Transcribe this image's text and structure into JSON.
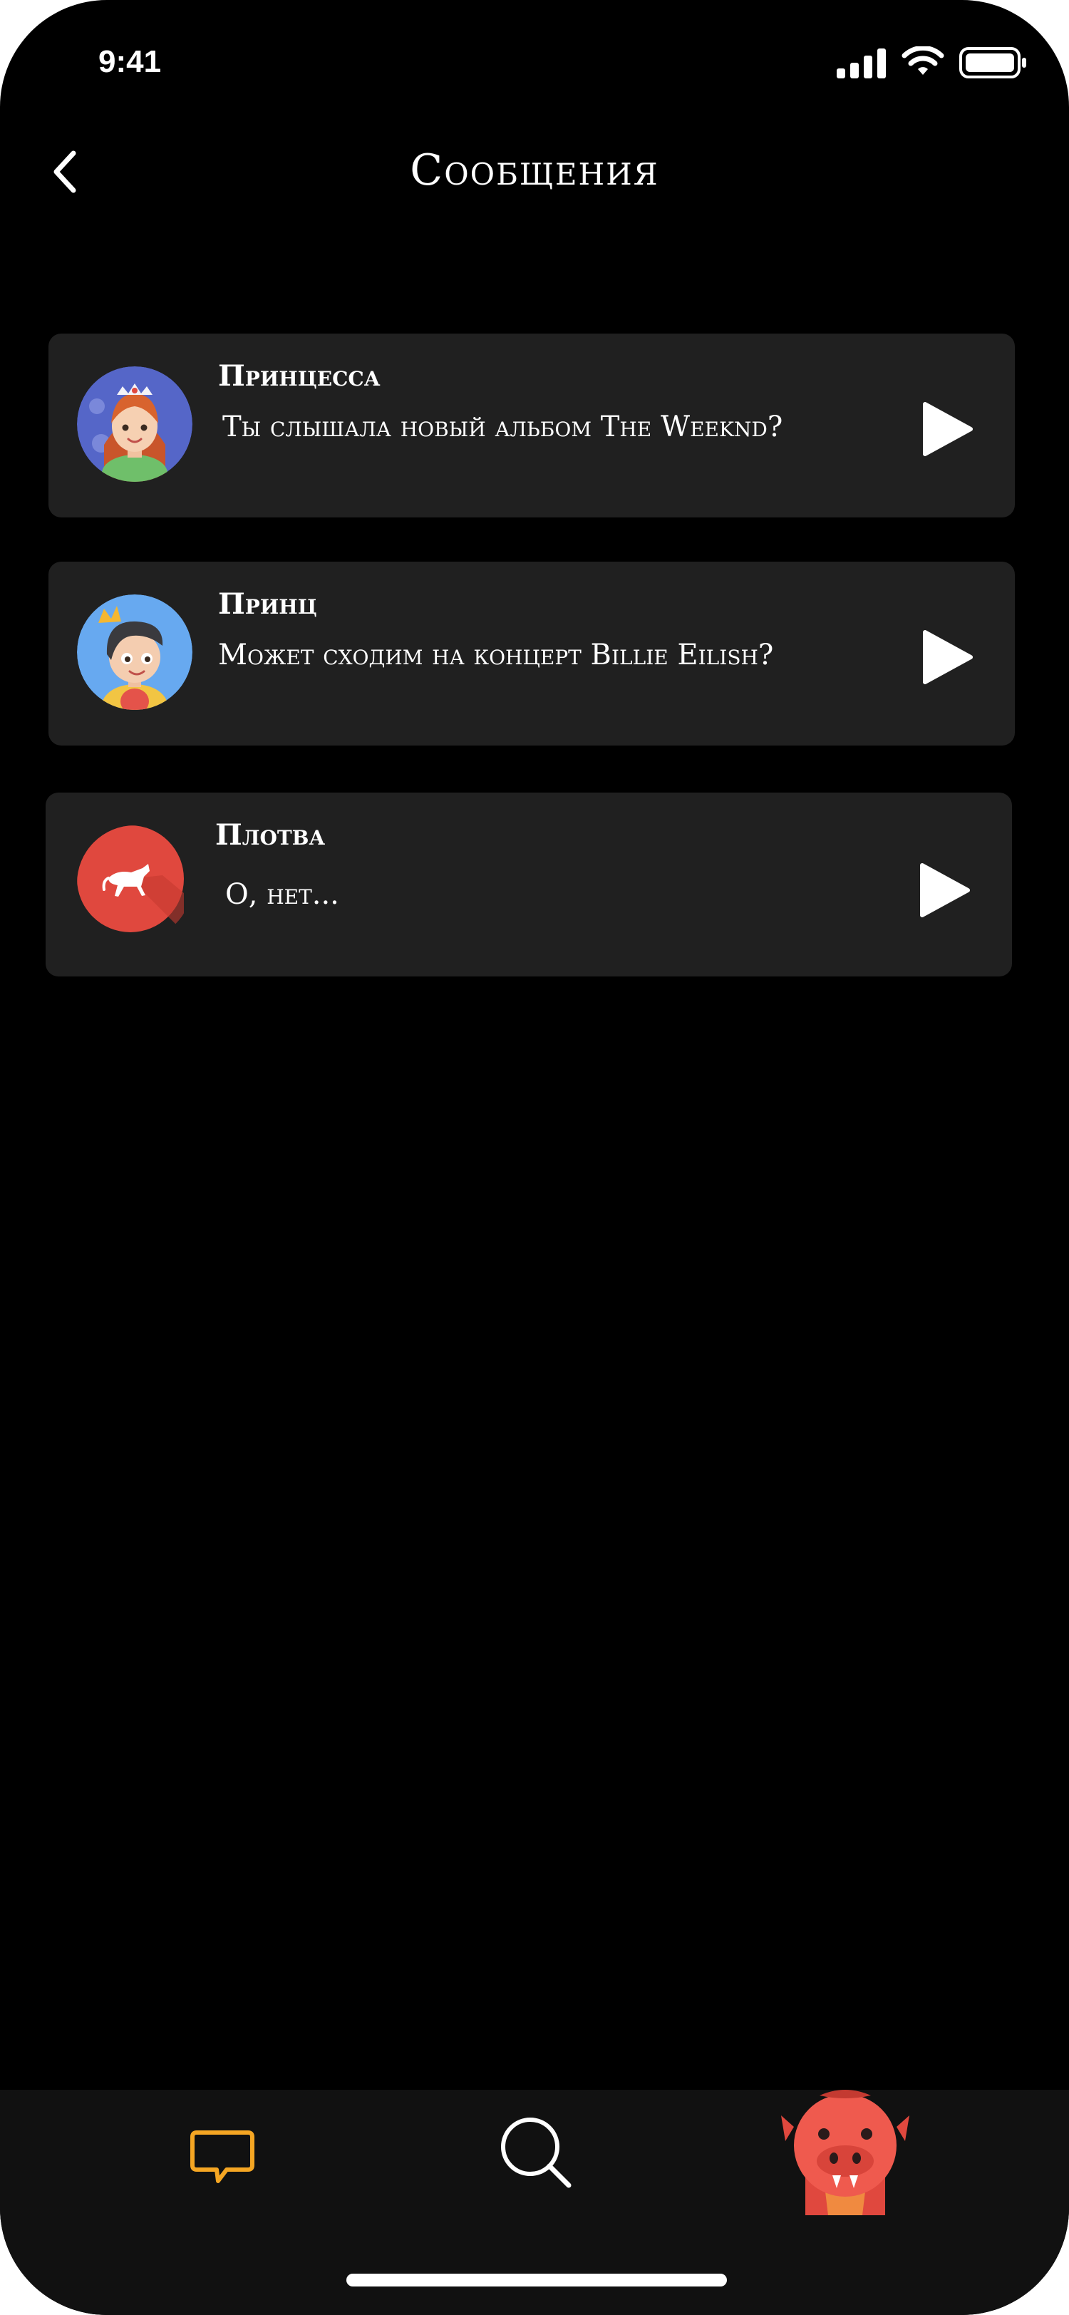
{
  "status_bar": {
    "time": "9:41"
  },
  "header": {
    "title": "Сообщения"
  },
  "messages": [
    {
      "name": "Принцесса",
      "text": "Ты слышала новый альбом The Weeknd?"
    },
    {
      "name": "Принц",
      "text": "Может сходим на концерт Billie Eilish?"
    },
    {
      "name": "Плотва",
      "text": "О, нет..."
    }
  ],
  "icons": {
    "back": "chevron-left-icon",
    "play": "play-icon",
    "chat": "chat-bubble-icon",
    "search": "search-icon",
    "profile": "monster-avatar-icon"
  },
  "colors": {
    "background": "#000000",
    "card": "#202020",
    "tabbar": "#111111",
    "accent": "#F5A623",
    "avatar_horse_bg": "#E0483E"
  }
}
